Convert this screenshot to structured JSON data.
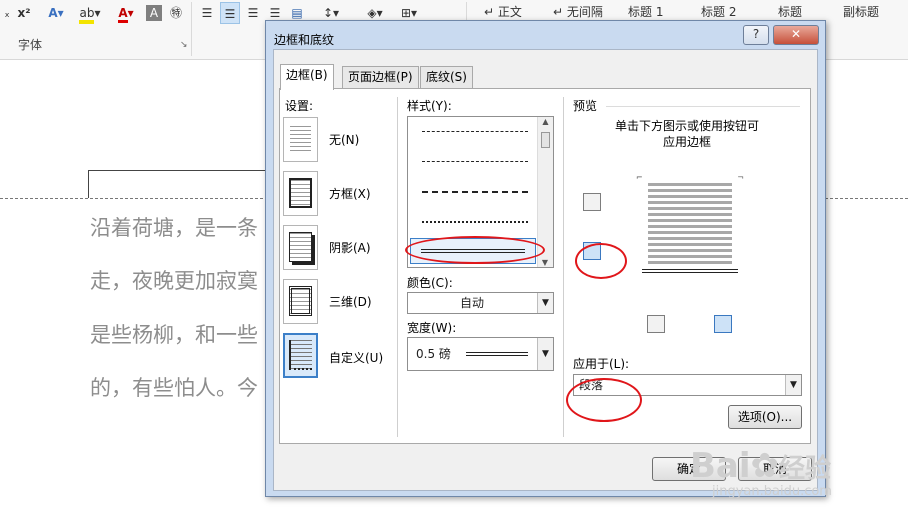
{
  "ribbon": {
    "font_group": "字体",
    "styles": [
      "↵ 正文",
      "↵ 无间隔",
      "标题 1",
      "标题 2",
      "标题",
      "副标题"
    ]
  },
  "document": {
    "lines": [
      "沿着荷塘，是一条",
      "走，夜晚更加寂寞",
      "是些杨柳，和一些",
      "的，有些怕人。今"
    ]
  },
  "dialog": {
    "title": "边框和底纹",
    "help": "?",
    "close": "✕",
    "tabs": [
      "边框(B)",
      "页面边框(P)",
      "底纹(S)"
    ],
    "settings_label": "设置:",
    "settings": [
      "无(N)",
      "方框(X)",
      "阴影(A)",
      "三维(D)",
      "自定义(U)"
    ],
    "style_label": "样式(Y):",
    "color_label": "颜色(C):",
    "color_value": "自动",
    "width_label": "宽度(W):",
    "width_value": "0.5 磅",
    "preview_label": "预览",
    "preview_hint_1": "单击下方图示或使用按钮可",
    "preview_hint_2": "应用边框",
    "apply_label": "应用于(L):",
    "apply_value": "段落",
    "options_button": "选项(O)...",
    "ok_button": "确定",
    "cancel_button": "取消"
  },
  "watermark": {
    "brand": "Bai",
    "text": "经验",
    "url": "jingyan.baidu.com"
  },
  "colors": {
    "annotation": "#e0161a",
    "dialog_frame": "#c9daf0"
  }
}
